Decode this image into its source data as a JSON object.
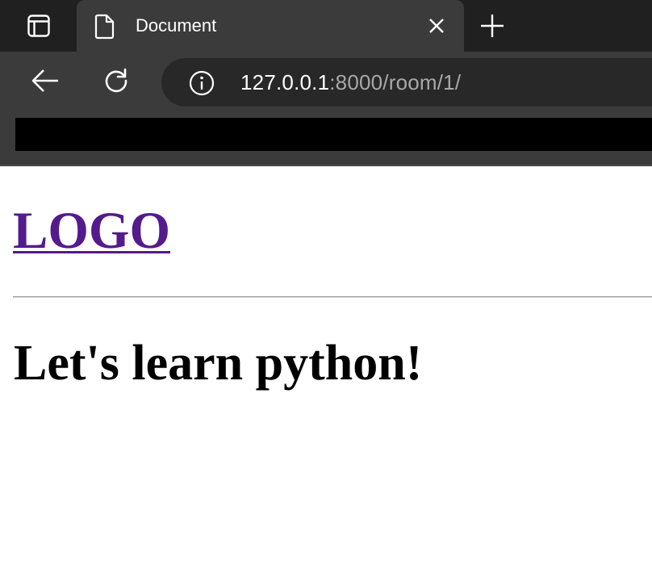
{
  "browser": {
    "tab": {
      "title": "Document"
    },
    "address_bar": {
      "host": "127.0.0.1",
      "rest": ":8000/room/1/"
    },
    "icons": {
      "tab_actions": "tab-actions-icon",
      "tab_document": "document-icon",
      "tab_close": "close-icon",
      "new_tab": "plus-icon",
      "back": "back-arrow-icon",
      "reload": "reload-icon",
      "site_info": "info-icon"
    },
    "colors": {
      "tabstrip": "#202020",
      "active_tab": "#3b3b3b",
      "omnibox": "#282828",
      "bookmarks_bar": "#000000"
    }
  },
  "page": {
    "logo": {
      "text": "LOGO",
      "color": "#551a8b"
    },
    "room": {
      "title": "Let's learn python!"
    }
  }
}
